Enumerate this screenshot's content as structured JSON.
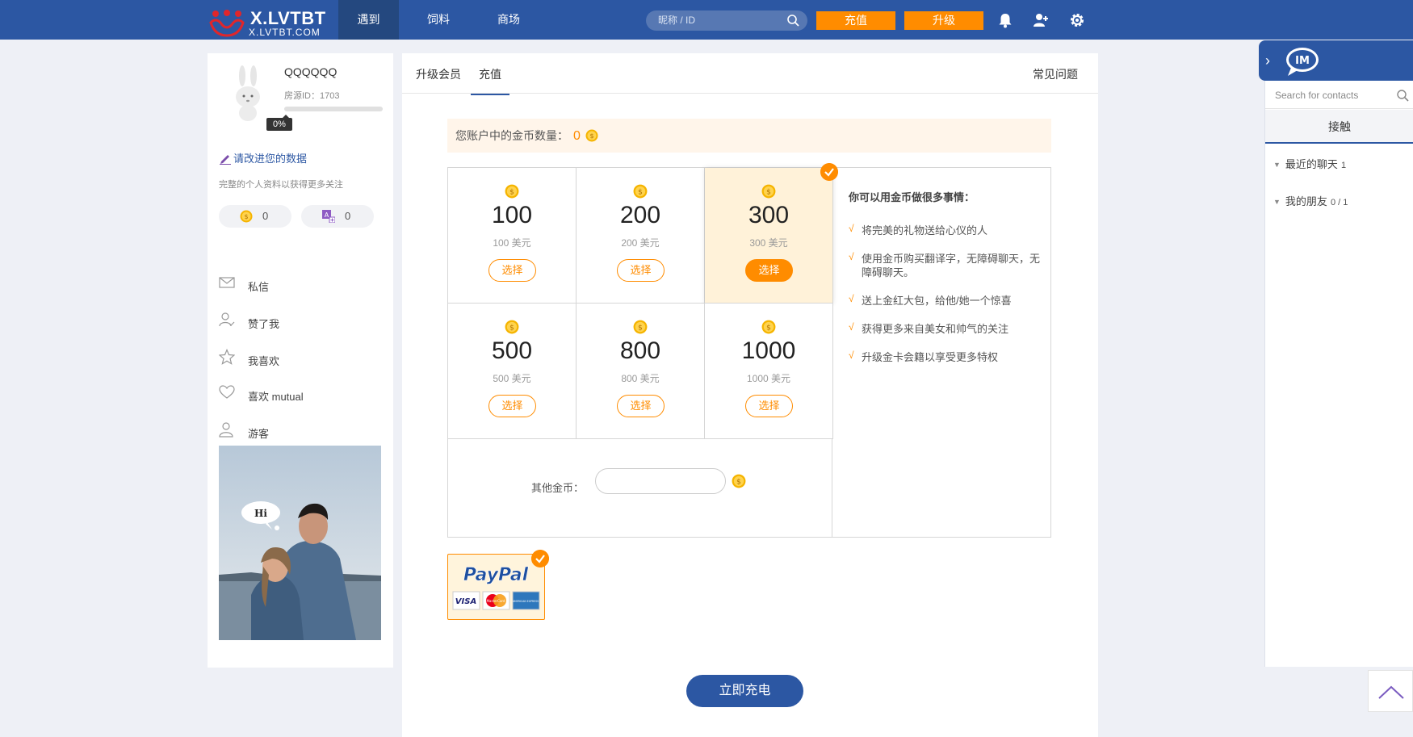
{
  "brand": {
    "name": "X.LVTBT",
    "domain": "X.LVTBT.COM"
  },
  "nav": [
    {
      "label": "遇到"
    },
    {
      "label": "饲料"
    },
    {
      "label": "商场"
    }
  ],
  "search": {
    "placeholder": "昵称 / ID"
  },
  "header_buttons": {
    "recharge": "充值",
    "upgrade": "升级"
  },
  "profile": {
    "name": "QQQQQQ",
    "id_label": "房源ID：1703",
    "progress": "0%",
    "progress_value": 0,
    "edit_link": "请改进您的数据",
    "hint": "完整的个人资料以获得更多关注",
    "coins": "0",
    "credits": "0"
  },
  "menu": [
    {
      "label": "私信",
      "icon": "envelope-icon"
    },
    {
      "label": "赞了我",
      "icon": "user-check-icon"
    },
    {
      "label": "我喜欢",
      "icon": "star-icon"
    },
    {
      "label": "喜欢 mutual",
      "icon": "heart-icon"
    },
    {
      "label": "游客",
      "icon": "visitor-icon"
    }
  ],
  "promo_photo": {
    "speech": "Hi"
  },
  "tabs": {
    "upgrade": "升级会员",
    "recharge": "充值",
    "faq": "常见问题"
  },
  "balance": {
    "label": "您账户中的金币数量：",
    "value": "0"
  },
  "packages": [
    {
      "amount": "100",
      "usd": "100 美元",
      "select": "选择",
      "selected": false
    },
    {
      "amount": "200",
      "usd": "200 美元",
      "select": "选择",
      "selected": false
    },
    {
      "amount": "300",
      "usd": "300 美元",
      "select": "选择",
      "selected": true
    },
    {
      "amount": "500",
      "usd": "500 美元",
      "select": "选择",
      "selected": false
    },
    {
      "amount": "800",
      "usd": "800 美元",
      "select": "选择",
      "selected": false
    },
    {
      "amount": "1000",
      "usd": "1000 美元",
      "select": "选择",
      "selected": false
    }
  ],
  "other_coins": {
    "label": "其他金币：",
    "value": ""
  },
  "benefits": {
    "title": "你可以用金币做很多事情：",
    "items": [
      "将完美的礼物送给心仪的人",
      "使用金币购买翻译字，无障碍聊天，无障碍聊天。",
      "送上金红大包，给他/她一个惊喜",
      "获得更多来自美女和帅气的关注",
      "升级金卡会籍以享受更多特权"
    ]
  },
  "payment": {
    "method": "PayPal",
    "cards": [
      "VISA",
      "MasterCard",
      "AMERICAN EXPRESS"
    ]
  },
  "recharge_button": "立即充电",
  "im": {
    "badge": "IM",
    "search_placeholder": "Search for contacts",
    "tab": "接触",
    "groups": [
      {
        "label": "最近的聊天",
        "count": "1"
      },
      {
        "label": "我的朋友",
        "count": "0 / 1"
      }
    ]
  },
  "colors": {
    "primary": "#2c57a3",
    "accent": "#ff8c00",
    "selected_bg": "#fff2d9"
  }
}
